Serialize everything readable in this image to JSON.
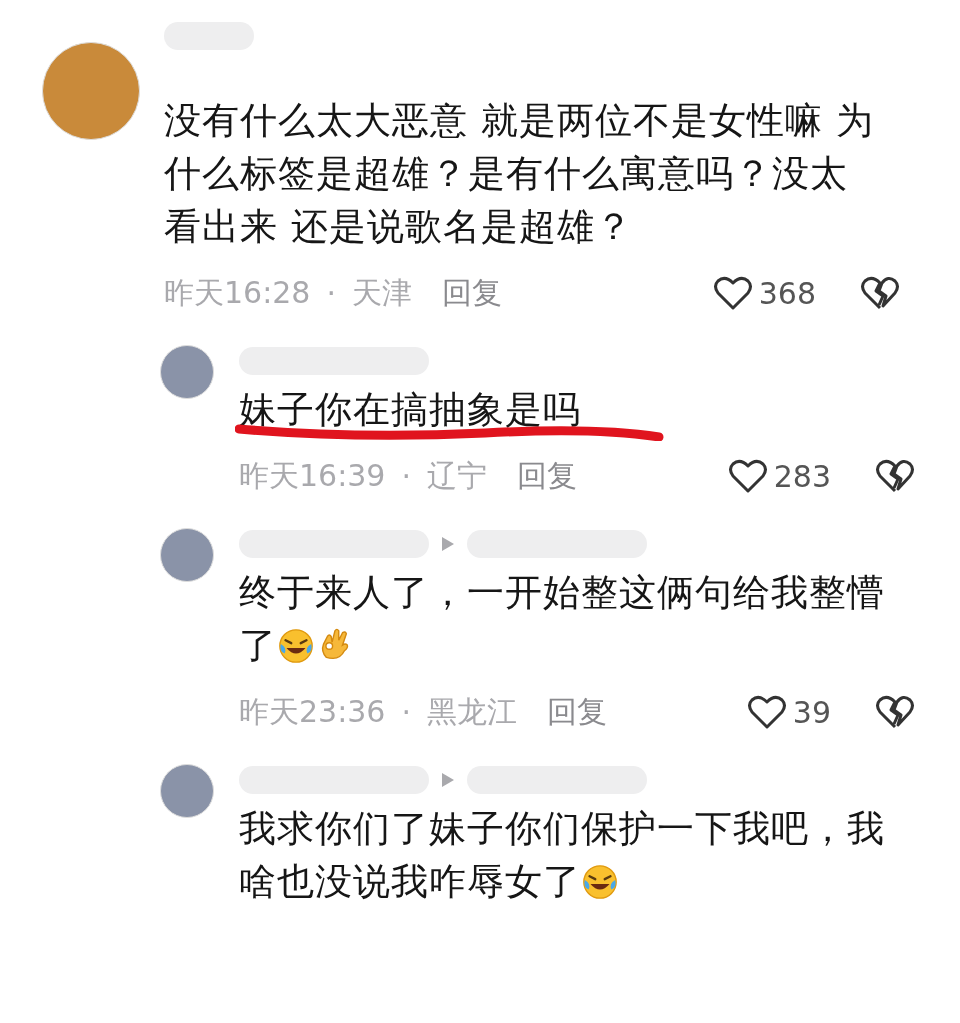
{
  "comment": {
    "lines": [
      "没有什么太大恶意 就是两位不是女性嘛 为",
      "什么标签是超雄？是有什么寓意吗？没太",
      "看出来 还是说歌名是超雄？"
    ],
    "time": "昨天16:28",
    "separator": "·",
    "location": "天津",
    "reply_label": "回复",
    "likes": "368",
    "underlined": false
  },
  "replies": [
    {
      "reply_to": false,
      "lines": [
        "妹子你在搞抽象是吗"
      ],
      "time": "昨天16:39",
      "separator": "·",
      "location": "辽宁",
      "reply_label": "回复",
      "likes": "283",
      "underlined": true
    },
    {
      "reply_to": true,
      "lines": [
        "终于来人了，一开始整这俩句给我整懵",
        "了"
      ],
      "time": "昨天23:36",
      "separator": "·",
      "location": "黑龙江",
      "reply_label": "回复",
      "likes": "39",
      "underlined": false,
      "emojis": [
        {
          "kind": "laugh-cry"
        },
        {
          "kind": "ok-hand"
        }
      ]
    },
    {
      "reply_to": true,
      "lines": [
        "我求你们了妹子你们保护一下我吧，我",
        "啥也没说我咋辱女了"
      ],
      "underlined": false,
      "emojis": [
        {
          "kind": "laugh-cry"
        }
      ]
    }
  ]
}
